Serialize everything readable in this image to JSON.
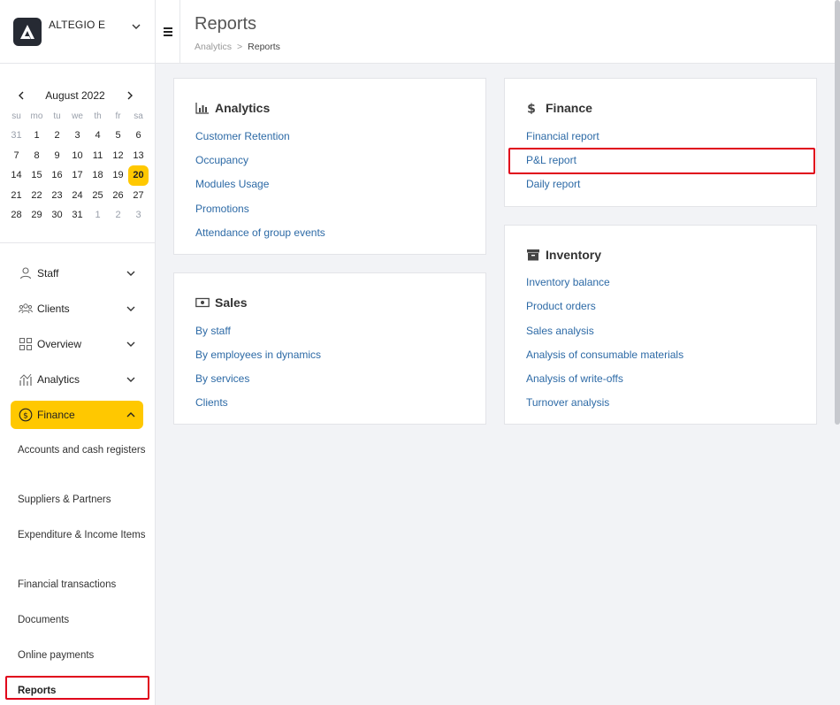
{
  "company": {
    "name": "ALTEGIO E"
  },
  "calendar": {
    "month": "August 2022",
    "weekdays": [
      "su",
      "mo",
      "tu",
      "we",
      "th",
      "fr",
      "sa"
    ],
    "days": [
      "31",
      "1",
      "2",
      "3",
      "4",
      "5",
      "6",
      "7",
      "8",
      "9",
      "10",
      "11",
      "12",
      "13",
      "14",
      "15",
      "16",
      "17",
      "18",
      "19",
      "20",
      "21",
      "22",
      "23",
      "24",
      "25",
      "26",
      "27",
      "28",
      "29",
      "30",
      "31",
      "1",
      "2",
      "3"
    ]
  },
  "menu": {
    "staff": "Staff",
    "clients": "Clients",
    "overview": "Overview",
    "analytics": "Analytics",
    "finance": "Finance"
  },
  "finance_sub": {
    "accounts": "Accounts and cash registers",
    "suppliers": "Suppliers & Partners",
    "expenditure": "Expenditure & Income Items",
    "transactions": "Financial transactions",
    "documents": "Documents",
    "online_payments": "Online payments",
    "reports": "Reports"
  },
  "header": {
    "title": "Reports",
    "breadcrumb_root": "Analytics",
    "breadcrumb_sep": ">",
    "breadcrumb_current": "Reports"
  },
  "cards": {
    "analytics": {
      "title": "Analytics",
      "links": [
        "Customer Retention",
        "Occupancy",
        "Modules Usage",
        "Promotions",
        "Attendance of group events"
      ]
    },
    "sales": {
      "title": "Sales",
      "links": [
        "By staff",
        "By employees in dynamics",
        "By services",
        "Clients"
      ]
    },
    "finance": {
      "title": "Finance",
      "links": [
        "Financial report",
        "P&L report",
        "Daily report"
      ]
    },
    "inventory": {
      "title": "Inventory",
      "links": [
        "Inventory balance",
        "Product orders",
        "Sales analysis",
        "Analysis of consumable materials",
        "Analysis of write-offs",
        "Turnover analysis"
      ]
    }
  },
  "colors": {
    "accent": "#ffc800",
    "link": "#2d6aa6",
    "highlight": "#e0001b"
  }
}
